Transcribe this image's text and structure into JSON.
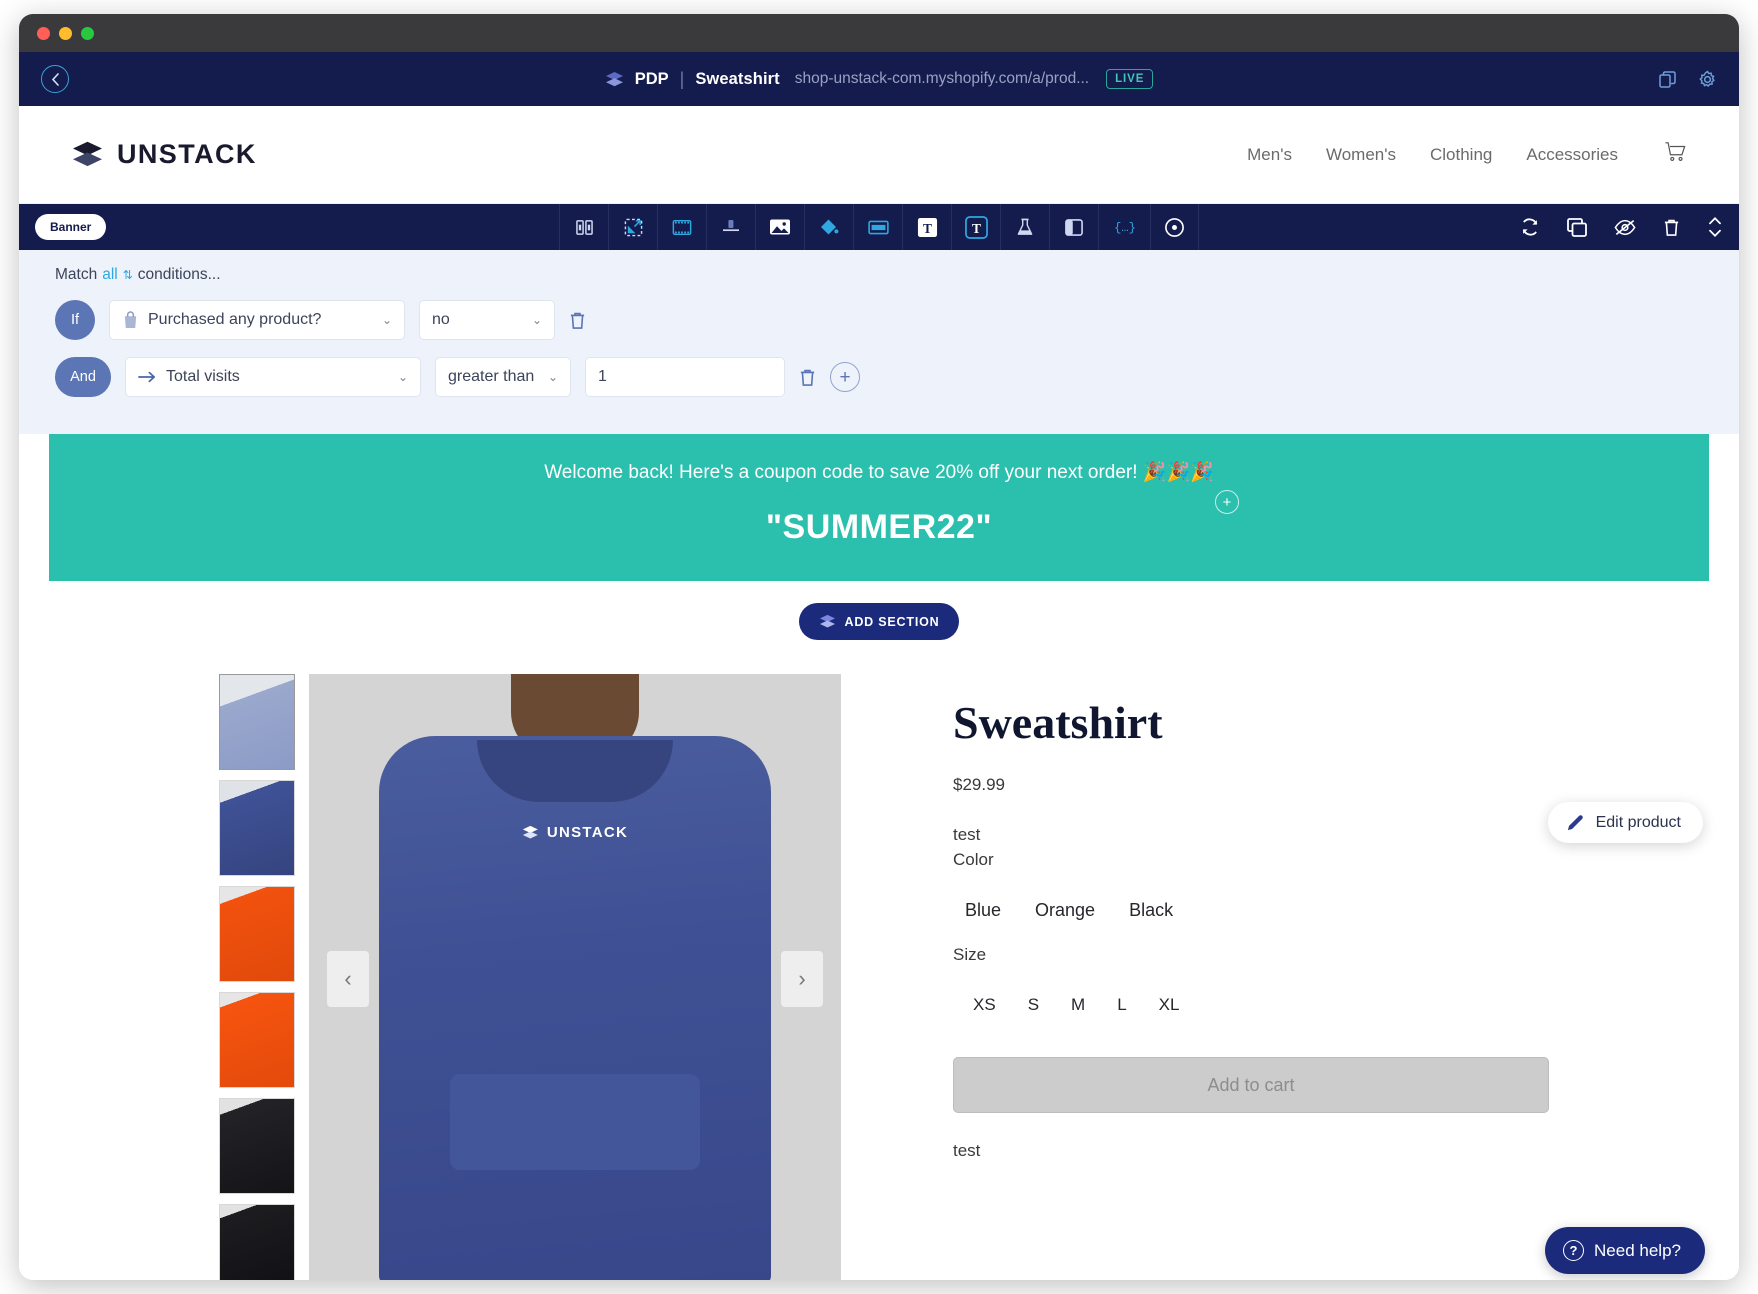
{
  "window": {
    "traffic_lights": [
      "close",
      "minimize",
      "zoom"
    ]
  },
  "topbar": {
    "back_icon": "chevron-left-icon",
    "logo_icon": "unstack-stack-icon",
    "crumb_page": "PDP",
    "crumb_separator": "|",
    "crumb_title": "Sweatshirt",
    "url": "shop-unstack-com.myshopify.com/a/prod...",
    "live_badge": "LIVE",
    "right_icons": [
      "duplicate-icon",
      "gear-icon"
    ]
  },
  "site_header": {
    "brand": "UNSTACK",
    "nav": [
      {
        "label": "Men's"
      },
      {
        "label": "Women's"
      },
      {
        "label": "Clothing"
      },
      {
        "label": "Accessories"
      }
    ],
    "cart_icon": "shopping-cart-icon"
  },
  "editor_toolbar": {
    "section_chip": "Banner",
    "tools": [
      {
        "name": "columns-icon"
      },
      {
        "name": "select-area-icon"
      },
      {
        "name": "film-strip-icon"
      },
      {
        "name": "align-icon"
      },
      {
        "name": "image-icon"
      },
      {
        "name": "fill-color-icon"
      },
      {
        "name": "button-icon"
      },
      {
        "name": "text-light-icon"
      },
      {
        "name": "text-dark-icon"
      },
      {
        "name": "flask-icon"
      },
      {
        "name": "split-layout-icon"
      },
      {
        "name": "code-embed-icon"
      },
      {
        "name": "target-icon"
      }
    ],
    "right_tools": [
      {
        "name": "refresh-icon"
      },
      {
        "name": "duplicate-section-icon"
      },
      {
        "name": "hide-eye-icon"
      },
      {
        "name": "delete-trash-icon"
      },
      {
        "name": "move-updown-icon"
      }
    ]
  },
  "conditions": {
    "match_prefix": "Match",
    "match_value": "all",
    "match_suffix": "conditions...",
    "rows": [
      {
        "connector": "If",
        "field_icon": "shopping-bag-icon",
        "field": "Purchased any product?",
        "value": "no",
        "has_operator": false,
        "delete_icon": "trash-icon"
      },
      {
        "connector": "And",
        "field_icon": "arrow-right-icon",
        "field": "Total visits",
        "operator": "greater than",
        "value": "1",
        "has_operator": true,
        "delete_icon": "trash-icon",
        "add_icon": "plus-icon"
      }
    ]
  },
  "banner": {
    "message": "Welcome back! Here's a coupon code to save 20% off your next order! 🎉🎉🎉",
    "code": "\"SUMMER22\"",
    "background_color": "#2bbfae",
    "add_block_icon": "plus-icon"
  },
  "add_section": {
    "label": "ADD SECTION",
    "icon": "stack-icon"
  },
  "edit_product": {
    "label": "Edit product",
    "icon": "pencil-icon"
  },
  "product": {
    "title": "Sweatshirt",
    "price": "$29.99",
    "description_top": "test",
    "color_label": "Color",
    "colors": [
      "Blue",
      "Orange",
      "Black"
    ],
    "size_label": "Size",
    "sizes": [
      "XS",
      "S",
      "M",
      "L",
      "XL"
    ],
    "add_to_cart_label": "Add to cart",
    "description_bottom": "test",
    "hero_logo": "UNSTACK",
    "prev_icon": "chevron-left-icon",
    "next_icon": "chevron-right-icon",
    "thumbnails": [
      {
        "color": "#97a6cc",
        "name": "light-blue-hoodie"
      },
      {
        "color": "#3c4f94",
        "name": "blue-hoodie"
      },
      {
        "color": "#f0500f",
        "name": "orange-hoodie-front"
      },
      {
        "color": "#f4530f",
        "name": "orange-hoodie-back"
      },
      {
        "color": "#1f1f22",
        "name": "black-hoodie-front"
      },
      {
        "color": "#18181b",
        "name": "black-hoodie-back"
      }
    ]
  },
  "support": {
    "label": "Need help?",
    "icon": "question-mark-icon"
  },
  "colors": {
    "navy": "#141b4d",
    "accent_blue": "#2fa8e0",
    "teal": "#2bbfae",
    "pill_blue": "#5b75b5"
  }
}
